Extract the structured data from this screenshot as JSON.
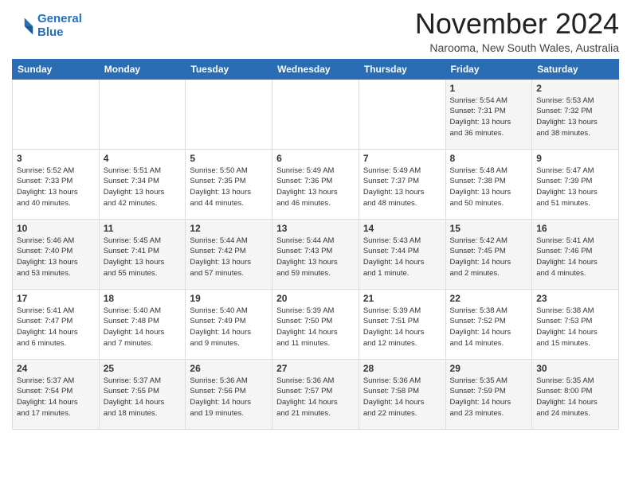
{
  "header": {
    "logo_line1": "General",
    "logo_line2": "Blue",
    "month_title": "November 2024",
    "subtitle": "Narooma, New South Wales, Australia"
  },
  "weekdays": [
    "Sunday",
    "Monday",
    "Tuesday",
    "Wednesday",
    "Thursday",
    "Friday",
    "Saturday"
  ],
  "weeks": [
    [
      {
        "day": "",
        "info": ""
      },
      {
        "day": "",
        "info": ""
      },
      {
        "day": "",
        "info": ""
      },
      {
        "day": "",
        "info": ""
      },
      {
        "day": "",
        "info": ""
      },
      {
        "day": "1",
        "info": "Sunrise: 5:54 AM\nSunset: 7:31 PM\nDaylight: 13 hours\nand 36 minutes."
      },
      {
        "day": "2",
        "info": "Sunrise: 5:53 AM\nSunset: 7:32 PM\nDaylight: 13 hours\nand 38 minutes."
      }
    ],
    [
      {
        "day": "3",
        "info": "Sunrise: 5:52 AM\nSunset: 7:33 PM\nDaylight: 13 hours\nand 40 minutes."
      },
      {
        "day": "4",
        "info": "Sunrise: 5:51 AM\nSunset: 7:34 PM\nDaylight: 13 hours\nand 42 minutes."
      },
      {
        "day": "5",
        "info": "Sunrise: 5:50 AM\nSunset: 7:35 PM\nDaylight: 13 hours\nand 44 minutes."
      },
      {
        "day": "6",
        "info": "Sunrise: 5:49 AM\nSunset: 7:36 PM\nDaylight: 13 hours\nand 46 minutes."
      },
      {
        "day": "7",
        "info": "Sunrise: 5:49 AM\nSunset: 7:37 PM\nDaylight: 13 hours\nand 48 minutes."
      },
      {
        "day": "8",
        "info": "Sunrise: 5:48 AM\nSunset: 7:38 PM\nDaylight: 13 hours\nand 50 minutes."
      },
      {
        "day": "9",
        "info": "Sunrise: 5:47 AM\nSunset: 7:39 PM\nDaylight: 13 hours\nand 51 minutes."
      }
    ],
    [
      {
        "day": "10",
        "info": "Sunrise: 5:46 AM\nSunset: 7:40 PM\nDaylight: 13 hours\nand 53 minutes."
      },
      {
        "day": "11",
        "info": "Sunrise: 5:45 AM\nSunset: 7:41 PM\nDaylight: 13 hours\nand 55 minutes."
      },
      {
        "day": "12",
        "info": "Sunrise: 5:44 AM\nSunset: 7:42 PM\nDaylight: 13 hours\nand 57 minutes."
      },
      {
        "day": "13",
        "info": "Sunrise: 5:44 AM\nSunset: 7:43 PM\nDaylight: 13 hours\nand 59 minutes."
      },
      {
        "day": "14",
        "info": "Sunrise: 5:43 AM\nSunset: 7:44 PM\nDaylight: 14 hours\nand 1 minute."
      },
      {
        "day": "15",
        "info": "Sunrise: 5:42 AM\nSunset: 7:45 PM\nDaylight: 14 hours\nand 2 minutes."
      },
      {
        "day": "16",
        "info": "Sunrise: 5:41 AM\nSunset: 7:46 PM\nDaylight: 14 hours\nand 4 minutes."
      }
    ],
    [
      {
        "day": "17",
        "info": "Sunrise: 5:41 AM\nSunset: 7:47 PM\nDaylight: 14 hours\nand 6 minutes."
      },
      {
        "day": "18",
        "info": "Sunrise: 5:40 AM\nSunset: 7:48 PM\nDaylight: 14 hours\nand 7 minutes."
      },
      {
        "day": "19",
        "info": "Sunrise: 5:40 AM\nSunset: 7:49 PM\nDaylight: 14 hours\nand 9 minutes."
      },
      {
        "day": "20",
        "info": "Sunrise: 5:39 AM\nSunset: 7:50 PM\nDaylight: 14 hours\nand 11 minutes."
      },
      {
        "day": "21",
        "info": "Sunrise: 5:39 AM\nSunset: 7:51 PM\nDaylight: 14 hours\nand 12 minutes."
      },
      {
        "day": "22",
        "info": "Sunrise: 5:38 AM\nSunset: 7:52 PM\nDaylight: 14 hours\nand 14 minutes."
      },
      {
        "day": "23",
        "info": "Sunrise: 5:38 AM\nSunset: 7:53 PM\nDaylight: 14 hours\nand 15 minutes."
      }
    ],
    [
      {
        "day": "24",
        "info": "Sunrise: 5:37 AM\nSunset: 7:54 PM\nDaylight: 14 hours\nand 17 minutes."
      },
      {
        "day": "25",
        "info": "Sunrise: 5:37 AM\nSunset: 7:55 PM\nDaylight: 14 hours\nand 18 minutes."
      },
      {
        "day": "26",
        "info": "Sunrise: 5:36 AM\nSunset: 7:56 PM\nDaylight: 14 hours\nand 19 minutes."
      },
      {
        "day": "27",
        "info": "Sunrise: 5:36 AM\nSunset: 7:57 PM\nDaylight: 14 hours\nand 21 minutes."
      },
      {
        "day": "28",
        "info": "Sunrise: 5:36 AM\nSunset: 7:58 PM\nDaylight: 14 hours\nand 22 minutes."
      },
      {
        "day": "29",
        "info": "Sunrise: 5:35 AM\nSunset: 7:59 PM\nDaylight: 14 hours\nand 23 minutes."
      },
      {
        "day": "30",
        "info": "Sunrise: 5:35 AM\nSunset: 8:00 PM\nDaylight: 14 hours\nand 24 minutes."
      }
    ]
  ]
}
